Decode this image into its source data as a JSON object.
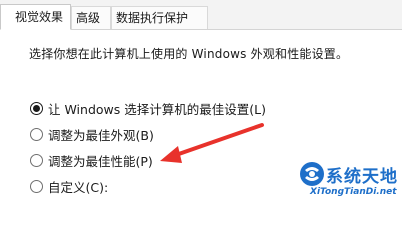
{
  "tabs": [
    {
      "label": "视觉效果",
      "active": true
    },
    {
      "label": "高级",
      "active": false
    },
    {
      "label": "数据执行保护",
      "active": false
    }
  ],
  "description": "选择你想在此计算机上使用的 Windows 外观和性能设置。",
  "options": [
    {
      "label": "让 Windows 选择计算机的最佳设置(L)",
      "checked": true
    },
    {
      "label": "调整为最佳外观(B)",
      "checked": false
    },
    {
      "label": "调整为最佳性能(P)",
      "checked": false
    },
    {
      "label": "自定义(C):",
      "checked": false
    }
  ],
  "annotation": {
    "arrow_color": "#e8322b"
  },
  "watermark": {
    "title": "系统天地",
    "url": "XiTongTianDi.net",
    "color": "#1e6fc9"
  }
}
